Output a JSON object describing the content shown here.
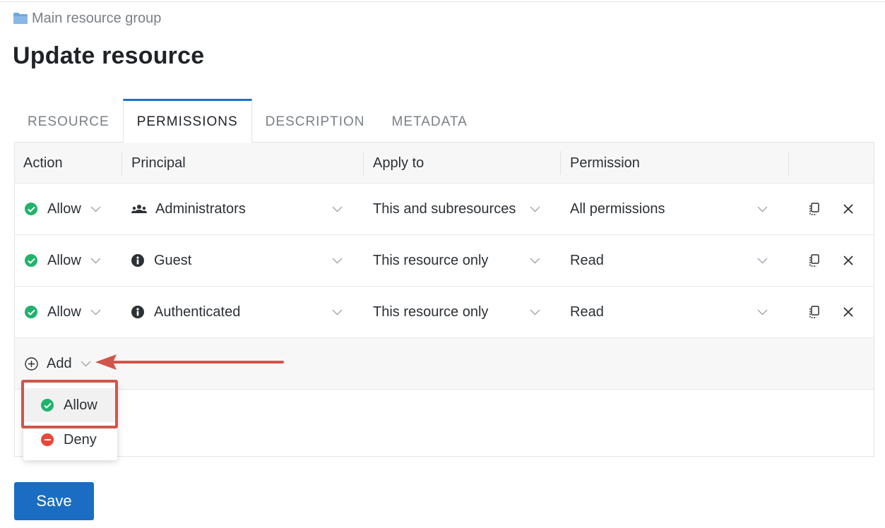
{
  "breadcrumb": {
    "label": "Main resource group",
    "icon": "folder-icon"
  },
  "page_title": "Update resource",
  "tabs": [
    {
      "label": "RESOURCE",
      "active": false
    },
    {
      "label": "PERMISSIONS",
      "active": true
    },
    {
      "label": "DESCRIPTION",
      "active": false
    },
    {
      "label": "METADATA",
      "active": false
    }
  ],
  "table": {
    "headers": [
      "Action",
      "Principal",
      "Apply to",
      "Permission"
    ],
    "rows": [
      {
        "action": "Allow",
        "principal": "Administrators",
        "principal_icon": "users-icon",
        "apply_to": "This and subresources",
        "permission": "All permissions"
      },
      {
        "action": "Allow",
        "principal": "Guest",
        "principal_icon": "info-icon",
        "apply_to": "This resource only",
        "permission": "Read"
      },
      {
        "action": "Allow",
        "principal": "Authenticated",
        "principal_icon": "info-icon",
        "apply_to": "This resource only",
        "permission": "Read"
      }
    ]
  },
  "add": {
    "label": "Add"
  },
  "dropdown": {
    "items": [
      {
        "label": "Allow",
        "icon": "check-circle-icon",
        "highlighted": true
      },
      {
        "label": "Deny",
        "icon": "minus-circle-icon",
        "highlighted": false
      }
    ]
  },
  "save_label": "Save",
  "colors": {
    "accent": "#1a6dc2",
    "allow": "#21b36b",
    "deny": "#e8473a",
    "annotation": "#d0554a"
  }
}
